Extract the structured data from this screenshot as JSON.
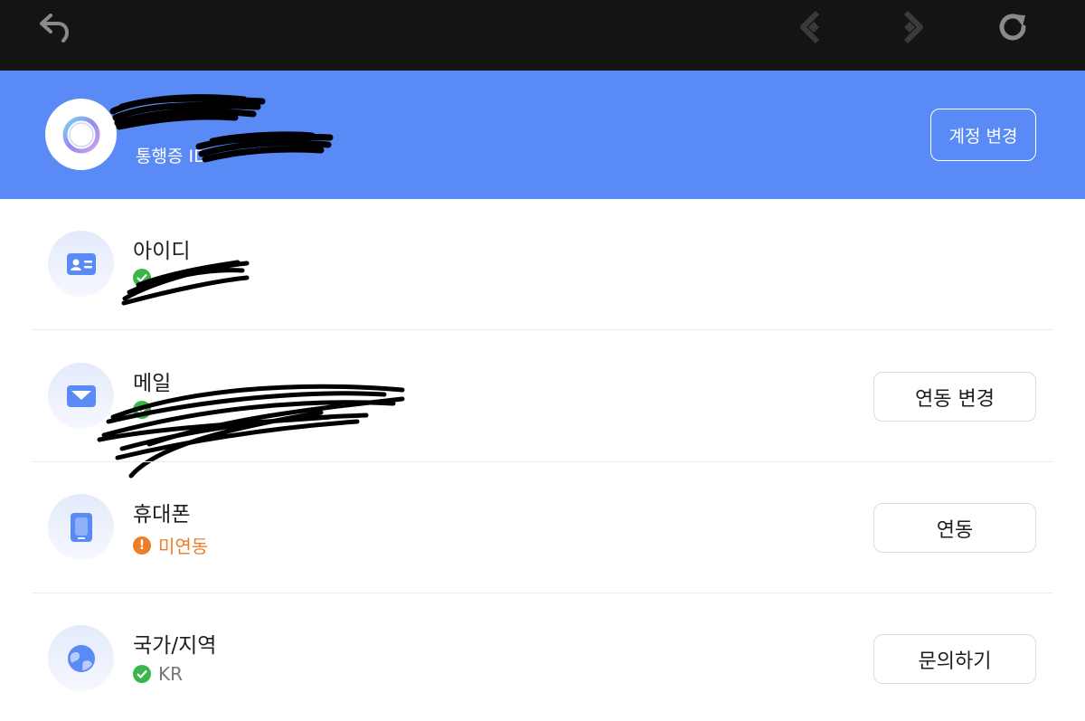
{
  "toolbar": {
    "icons": [
      "undo-arrow-icon",
      "previous-page-icon",
      "next-page-icon",
      "refresh-icon"
    ]
  },
  "header": {
    "username": "",
    "pass_id_label": "통행증 ID",
    "pass_id_value": "",
    "change_account_label": "계정 변경"
  },
  "rows": [
    {
      "icon": "id-card-icon",
      "title": "아이디",
      "status": "",
      "status_type": "ok"
    },
    {
      "icon": "mail-icon",
      "title": "메일",
      "status": "",
      "status_type": "ok",
      "action_label": "연동 변경"
    },
    {
      "icon": "phone-icon",
      "title": "휴대폰",
      "status": "미연동",
      "status_type": "warning",
      "action_label": "연동"
    },
    {
      "icon": "globe-icon",
      "title": "국가/지역",
      "status": "KR",
      "status_type": "ok",
      "action_label": "문의하기"
    }
  ],
  "colors": {
    "toolbar_bg": "#141414",
    "header_bg": "#5a8af5",
    "status_ok": "#3bb54a",
    "status_warning": "#ee7d2a",
    "icon_accent": "#5a8af5"
  }
}
